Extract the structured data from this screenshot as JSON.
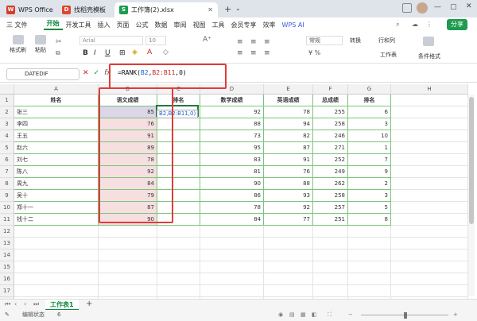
{
  "tabs": [
    {
      "label": "WPS Office"
    },
    {
      "label": "找稻壳模板"
    },
    {
      "label": "工作簿(2).xlsx"
    }
  ],
  "ribbon_tabs": [
    "三 文件",
    "开始",
    "开发工具",
    "插入",
    "页面",
    "公式",
    "数据",
    "审阅",
    "视图",
    "工具",
    "会员专享",
    "效率",
    "WPS AI"
  ],
  "share_label": "分享",
  "toolbar": {
    "format_painter": "格式刷",
    "paste": "粘贴",
    "font": "Arial",
    "size": "10",
    "number_format": "常规",
    "convert": "转换",
    "rows_cols": "行和列",
    "worksheet": "工作表",
    "cond_format": "条件格式"
  },
  "formula_bar": {
    "namebox": "DATEDIF",
    "formula_prefix": "=RANK(",
    "formula_arg1": "B2",
    "formula_sep1": ",",
    "formula_arg2": "B2:B11",
    "formula_suffix": ",0)"
  },
  "tooltip": {
    "line1": "B2,B2:B11,0)"
  },
  "columns": [
    "A",
    "B",
    "C",
    "D",
    "E",
    "F",
    "G",
    "H"
  ],
  "rows": [
    "1",
    "2",
    "3",
    "4",
    "5",
    "6",
    "7",
    "8",
    "9",
    "10",
    "11",
    "12",
    "13",
    "14",
    "15",
    "16",
    "17",
    "18"
  ],
  "headers": [
    "姓名",
    "语文成绩",
    "排名",
    "数学成绩",
    "英语成绩",
    "总成绩",
    "排名"
  ],
  "table": [
    {
      "name": "张三",
      "chinese": "85",
      "math": "92",
      "english": "78",
      "total": "255",
      "rank": "6"
    },
    {
      "name": "李四",
      "chinese": "76",
      "math": "88",
      "english": "94",
      "total": "258",
      "rank": "3"
    },
    {
      "name": "王五",
      "chinese": "91",
      "math": "73",
      "english": "82",
      "total": "246",
      "rank": "10"
    },
    {
      "name": "赵六",
      "chinese": "89",
      "math": "95",
      "english": "87",
      "total": "271",
      "rank": "1"
    },
    {
      "name": "刘七",
      "chinese": "78",
      "math": "83",
      "english": "91",
      "total": "252",
      "rank": "7"
    },
    {
      "name": "陈八",
      "chinese": "92",
      "math": "81",
      "english": "76",
      "total": "249",
      "rank": "9"
    },
    {
      "name": "周九",
      "chinese": "84",
      "math": "90",
      "english": "88",
      "total": "262",
      "rank": "2"
    },
    {
      "name": "吴十",
      "chinese": "79",
      "math": "86",
      "english": "93",
      "total": "258",
      "rank": "3"
    },
    {
      "name": "郑十一",
      "chinese": "87",
      "math": "78",
      "english": "92",
      "total": "257",
      "rank": "5"
    },
    {
      "name": "钱十二",
      "chinese": "90",
      "math": "84",
      "english": "77",
      "total": "251",
      "rank": "8"
    }
  ],
  "sheet_tab": "工作表1",
  "status": {
    "label": "编辑状态",
    "value": "6"
  },
  "colors": {
    "accent": "#0a8a3a",
    "highlight": "#e23a3a"
  }
}
